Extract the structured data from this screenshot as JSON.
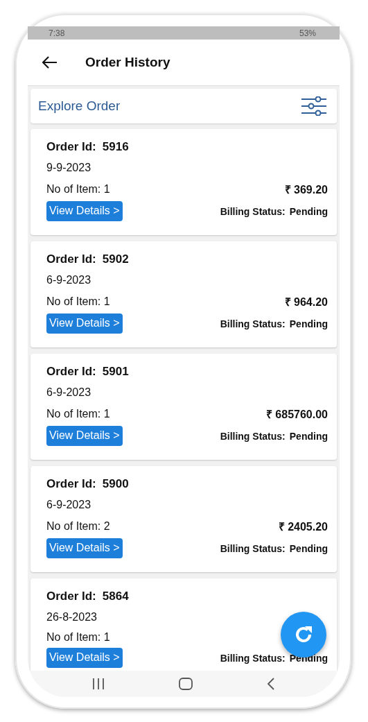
{
  "status_bar": {
    "time": "7:38",
    "battery": "53%"
  },
  "app_bar": {
    "title": "Order History"
  },
  "explore": {
    "title": "Explore Order"
  },
  "orders": [
    {
      "order_label": "Order Id:",
      "order_id": "5916",
      "date": "9-9-2023",
      "items": "No of Item: 1",
      "amount": "₹ 369.20",
      "button": "View Details >",
      "billing_label": "Billing Status:",
      "billing_status": "Pending"
    },
    {
      "order_label": "Order Id:",
      "order_id": "5902",
      "date": "6-9-2023",
      "items": "No of Item: 1",
      "amount": "₹ 964.20",
      "button": "View Details >",
      "billing_label": "Billing Status:",
      "billing_status": "Pending"
    },
    {
      "order_label": "Order Id:",
      "order_id": "5901",
      "date": "6-9-2023",
      "items": "No of Item: 1",
      "amount": "₹ 685760.00",
      "button": "View Details >",
      "billing_label": "Billing Status:",
      "billing_status": "Pending"
    },
    {
      "order_label": "Order Id:",
      "order_id": "5900",
      "date": "6-9-2023",
      "items": "No of Item: 2",
      "amount": "₹ 2405.20",
      "button": "View Details >",
      "billing_label": "Billing Status:",
      "billing_status": "Pending"
    },
    {
      "order_label": "Order Id:",
      "order_id": "5864",
      "date": "26-8-2023",
      "items": "No of Item: 1",
      "button": "View Details >",
      "billing_label": "Billing Status:",
      "billing_status": "Pending"
    }
  ]
}
